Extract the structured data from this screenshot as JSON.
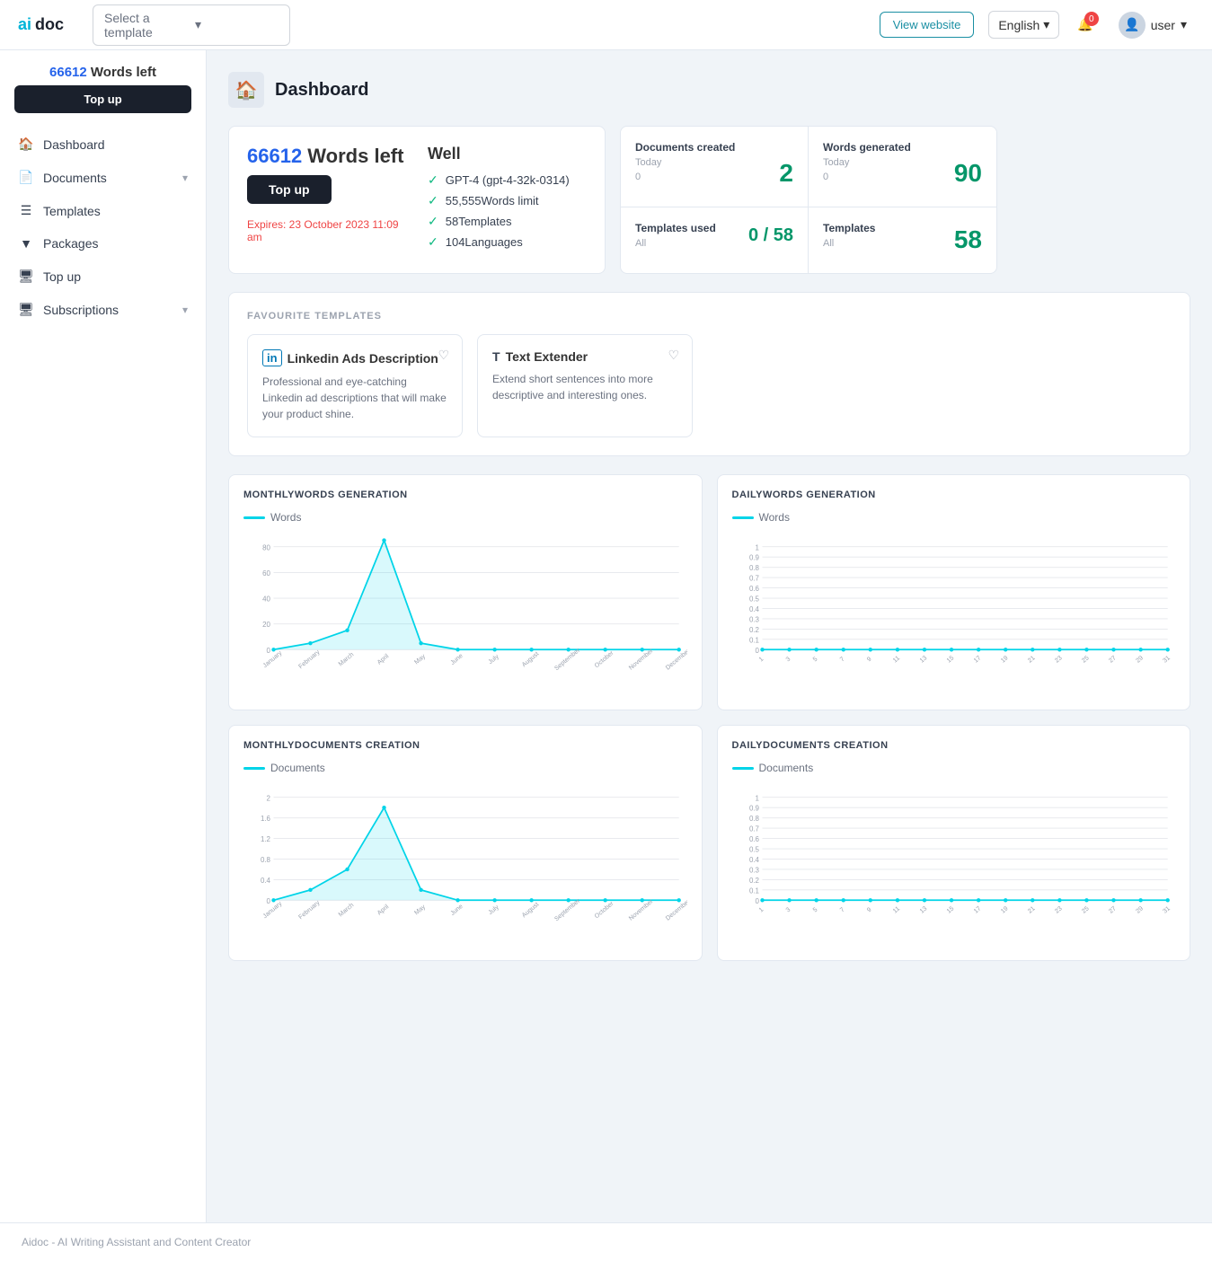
{
  "header": {
    "logo_ai": "ai",
    "logo_doc": "doc",
    "template_placeholder": "Select a template",
    "view_website_label": "View website",
    "lang": "English",
    "notif_count": "0",
    "user_label": "user"
  },
  "sidebar": {
    "words_left_number": "66612",
    "words_left_label": " Words left",
    "topup_label": "Top up",
    "nav": [
      {
        "id": "dashboard",
        "icon": "🏠",
        "label": "Dashboard",
        "has_chevron": false
      },
      {
        "id": "documents",
        "icon": "📄",
        "label": "Documents",
        "has_chevron": true
      },
      {
        "id": "templates",
        "icon": "☰",
        "label": "Templates",
        "has_chevron": false
      },
      {
        "id": "packages",
        "icon": "▼",
        "label": "Packages",
        "has_chevron": false
      },
      {
        "id": "topup",
        "icon": "🖥",
        "label": "Top up",
        "has_chevron": false
      },
      {
        "id": "subscriptions",
        "icon": "🖥",
        "label": "Subscriptions",
        "has_chevron": true
      }
    ]
  },
  "page": {
    "title": "Dashboard"
  },
  "plan_card": {
    "words_count": "66612",
    "words_label": " Words left",
    "topup_label": "Top up",
    "expires": "Expires: 23 October 2023 11:09 am",
    "well_title": "Well",
    "checks": [
      "GPT-4 (gpt-4-32k-0314)",
      "55,555Words limit",
      "58Templates",
      "104Languages"
    ]
  },
  "stats": [
    {
      "label": "Documents created",
      "sub": "Today",
      "sub2": "0",
      "value": "2"
    },
    {
      "label": "Words generated",
      "sub": "Today",
      "sub2": "0",
      "value": "90"
    },
    {
      "label": "Templates used",
      "sub": "All",
      "sub2": "",
      "value": "0 / 58"
    },
    {
      "label": "Templates",
      "sub": "All",
      "sub2": "",
      "value": "58"
    }
  ],
  "favourite_templates": {
    "section_title": "FAVOURITE TEMPLATES",
    "cards": [
      {
        "icon": "in",
        "title": "Linkedin Ads Description",
        "desc": "Professional and eye-catching Linkedin ad descriptions that will make your product shine."
      },
      {
        "icon": "T",
        "title": "Text Extender",
        "desc": "Extend short sentences into more descriptive and interesting ones."
      }
    ]
  },
  "charts": {
    "monthly_words": {
      "title": "MONTHLYWORDS GENERATION",
      "legend": "Words",
      "labels": [
        "January",
        "February",
        "March",
        "April",
        "May",
        "June",
        "July",
        "August",
        "September",
        "October",
        "November",
        "December"
      ],
      "values": [
        0,
        5,
        15,
        85,
        5,
        0,
        0,
        0,
        0,
        0,
        0,
        0
      ],
      "y_max": 80,
      "y_ticks": [
        0,
        20,
        40,
        60,
        80
      ]
    },
    "daily_words": {
      "title": "DAILYWORDS GENERATION",
      "legend": "Words",
      "labels": [
        "1",
        "3",
        "5",
        "7",
        "9",
        "11",
        "13",
        "15",
        "17",
        "19",
        "21",
        "23",
        "25",
        "27",
        "29",
        "31"
      ],
      "values": [
        0,
        0,
        0,
        0,
        0,
        0,
        0,
        0,
        0,
        0,
        0,
        0,
        0,
        0,
        0,
        0
      ],
      "y_max": 1.0,
      "y_ticks": [
        0,
        0.1,
        0.2,
        0.3,
        0.4,
        0.5,
        0.6,
        0.7,
        0.8,
        0.9,
        1.0
      ]
    },
    "monthly_docs": {
      "title": "MONTHLYDOCUMENTS CREATION",
      "legend": "Documents",
      "labels": [
        "January",
        "February",
        "March",
        "April",
        "May",
        "June",
        "July",
        "August",
        "September",
        "October",
        "November",
        "December"
      ],
      "values": [
        0,
        0.2,
        0.6,
        1.8,
        0.2,
        0,
        0,
        0,
        0,
        0,
        0,
        0
      ],
      "y_max": 2.0,
      "y_ticks": [
        0,
        0.4,
        0.8,
        1.2,
        1.6,
        2.0
      ]
    },
    "daily_docs": {
      "title": "DAILYDOCUMENTS CREATION",
      "legend": "Documents",
      "labels": [
        "1",
        "3",
        "5",
        "7",
        "9",
        "11",
        "13",
        "15",
        "17",
        "19",
        "21",
        "23",
        "25",
        "27",
        "29",
        "31"
      ],
      "values": [
        0,
        0,
        0,
        0,
        0,
        0,
        0,
        0,
        0,
        0,
        0,
        0,
        0,
        0,
        0,
        0
      ],
      "y_max": 1.0,
      "y_ticks": [
        0,
        0.1,
        0.2,
        0.3,
        0.4,
        0.5,
        0.6,
        0.7,
        0.8,
        0.9,
        1.0
      ]
    }
  },
  "footer": {
    "text": "Aidoc - AI Writing Assistant and Content Creator"
  }
}
